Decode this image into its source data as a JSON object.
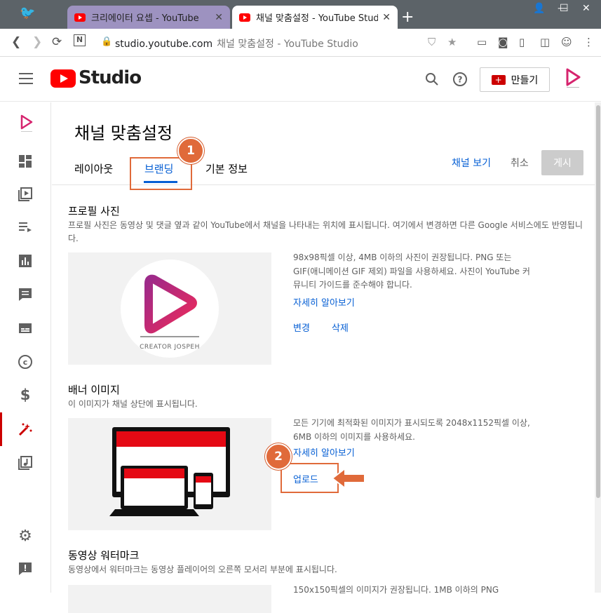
{
  "browser": {
    "tabs": [
      {
        "title": "크리에이터 요셉 - YouTube"
      },
      {
        "title": "채널 맞춤설정 - YouTube Studio"
      }
    ],
    "url_domain": "studio.youtube.com",
    "url_title": "채널 맞춤설정 - YouTube Studio"
  },
  "header": {
    "logo_text": "Studio",
    "create_label": "만들기"
  },
  "sidebar": {
    "items": [
      {
        "icon": "channel-avatar-icon"
      },
      {
        "icon": "dashboard-icon"
      },
      {
        "icon": "content-icon"
      },
      {
        "icon": "playlists-icon"
      },
      {
        "icon": "analytics-icon"
      },
      {
        "icon": "comments-icon"
      },
      {
        "icon": "subtitles-icon"
      },
      {
        "icon": "copyright-icon"
      },
      {
        "icon": "monetization-icon"
      },
      {
        "icon": "customization-icon"
      },
      {
        "icon": "audio-library-icon"
      },
      {
        "icon": "settings-icon"
      },
      {
        "icon": "feedback-icon"
      }
    ]
  },
  "main": {
    "page_title": "채널 맞춤설정",
    "tabs": [
      {
        "label": "레이아웃"
      },
      {
        "label": "브랜딩"
      },
      {
        "label": "기본 정보"
      }
    ],
    "view_channel": "채널 보기",
    "cancel": "취소",
    "publish": "게시",
    "profile": {
      "title": "프로필 사진",
      "desc": "프로필 사진은 동영상 및 댓글 옆과 같이 YouTube에서 채널을 나타내는 위치에 표시됩니다. 여기에서 변경하면 다른 Google 서비스에도 반영됩니다.",
      "info": "98x98픽셀 이상, 4MB 이하의 사진이 권장됩니다. PNG 또는 GIF(애니메이션 GIF 제외) 파일을 사용하세요. 사진이 YouTube 커뮤니티 가이드를 준수해야 합니다.",
      "learn_more": "자세히 알아보기",
      "change": "변경",
      "delete": "삭제",
      "logo_caption": "CREATOR JOSPEH"
    },
    "banner": {
      "title": "배너 이미지",
      "desc": "이 이미지가 채널 상단에 표시됩니다.",
      "info": "모든 기기에 최적화된 이미지가 표시되도록 2048x1152픽셀 이상, 6MB 이하의 이미지를 사용하세요.",
      "learn_more": "자세히 알아보기",
      "upload": "업로드"
    },
    "watermark": {
      "title": "동영상 워터마크",
      "desc": "동영상에서 워터마크는 동영상 플레이어의 오른쪽 모서리 부분에 표시됩니다.",
      "info": "150x150픽셀의 이미지가 권장됩니다. 1MB 이하의 PNG"
    }
  },
  "annotations": {
    "step1": "1",
    "step2": "2"
  },
  "colors": {
    "accent_blue": "#065fd4",
    "youtube_red": "#ff0000",
    "annotation_orange": "#e06a3a",
    "brand_pink": "#d6246e"
  }
}
